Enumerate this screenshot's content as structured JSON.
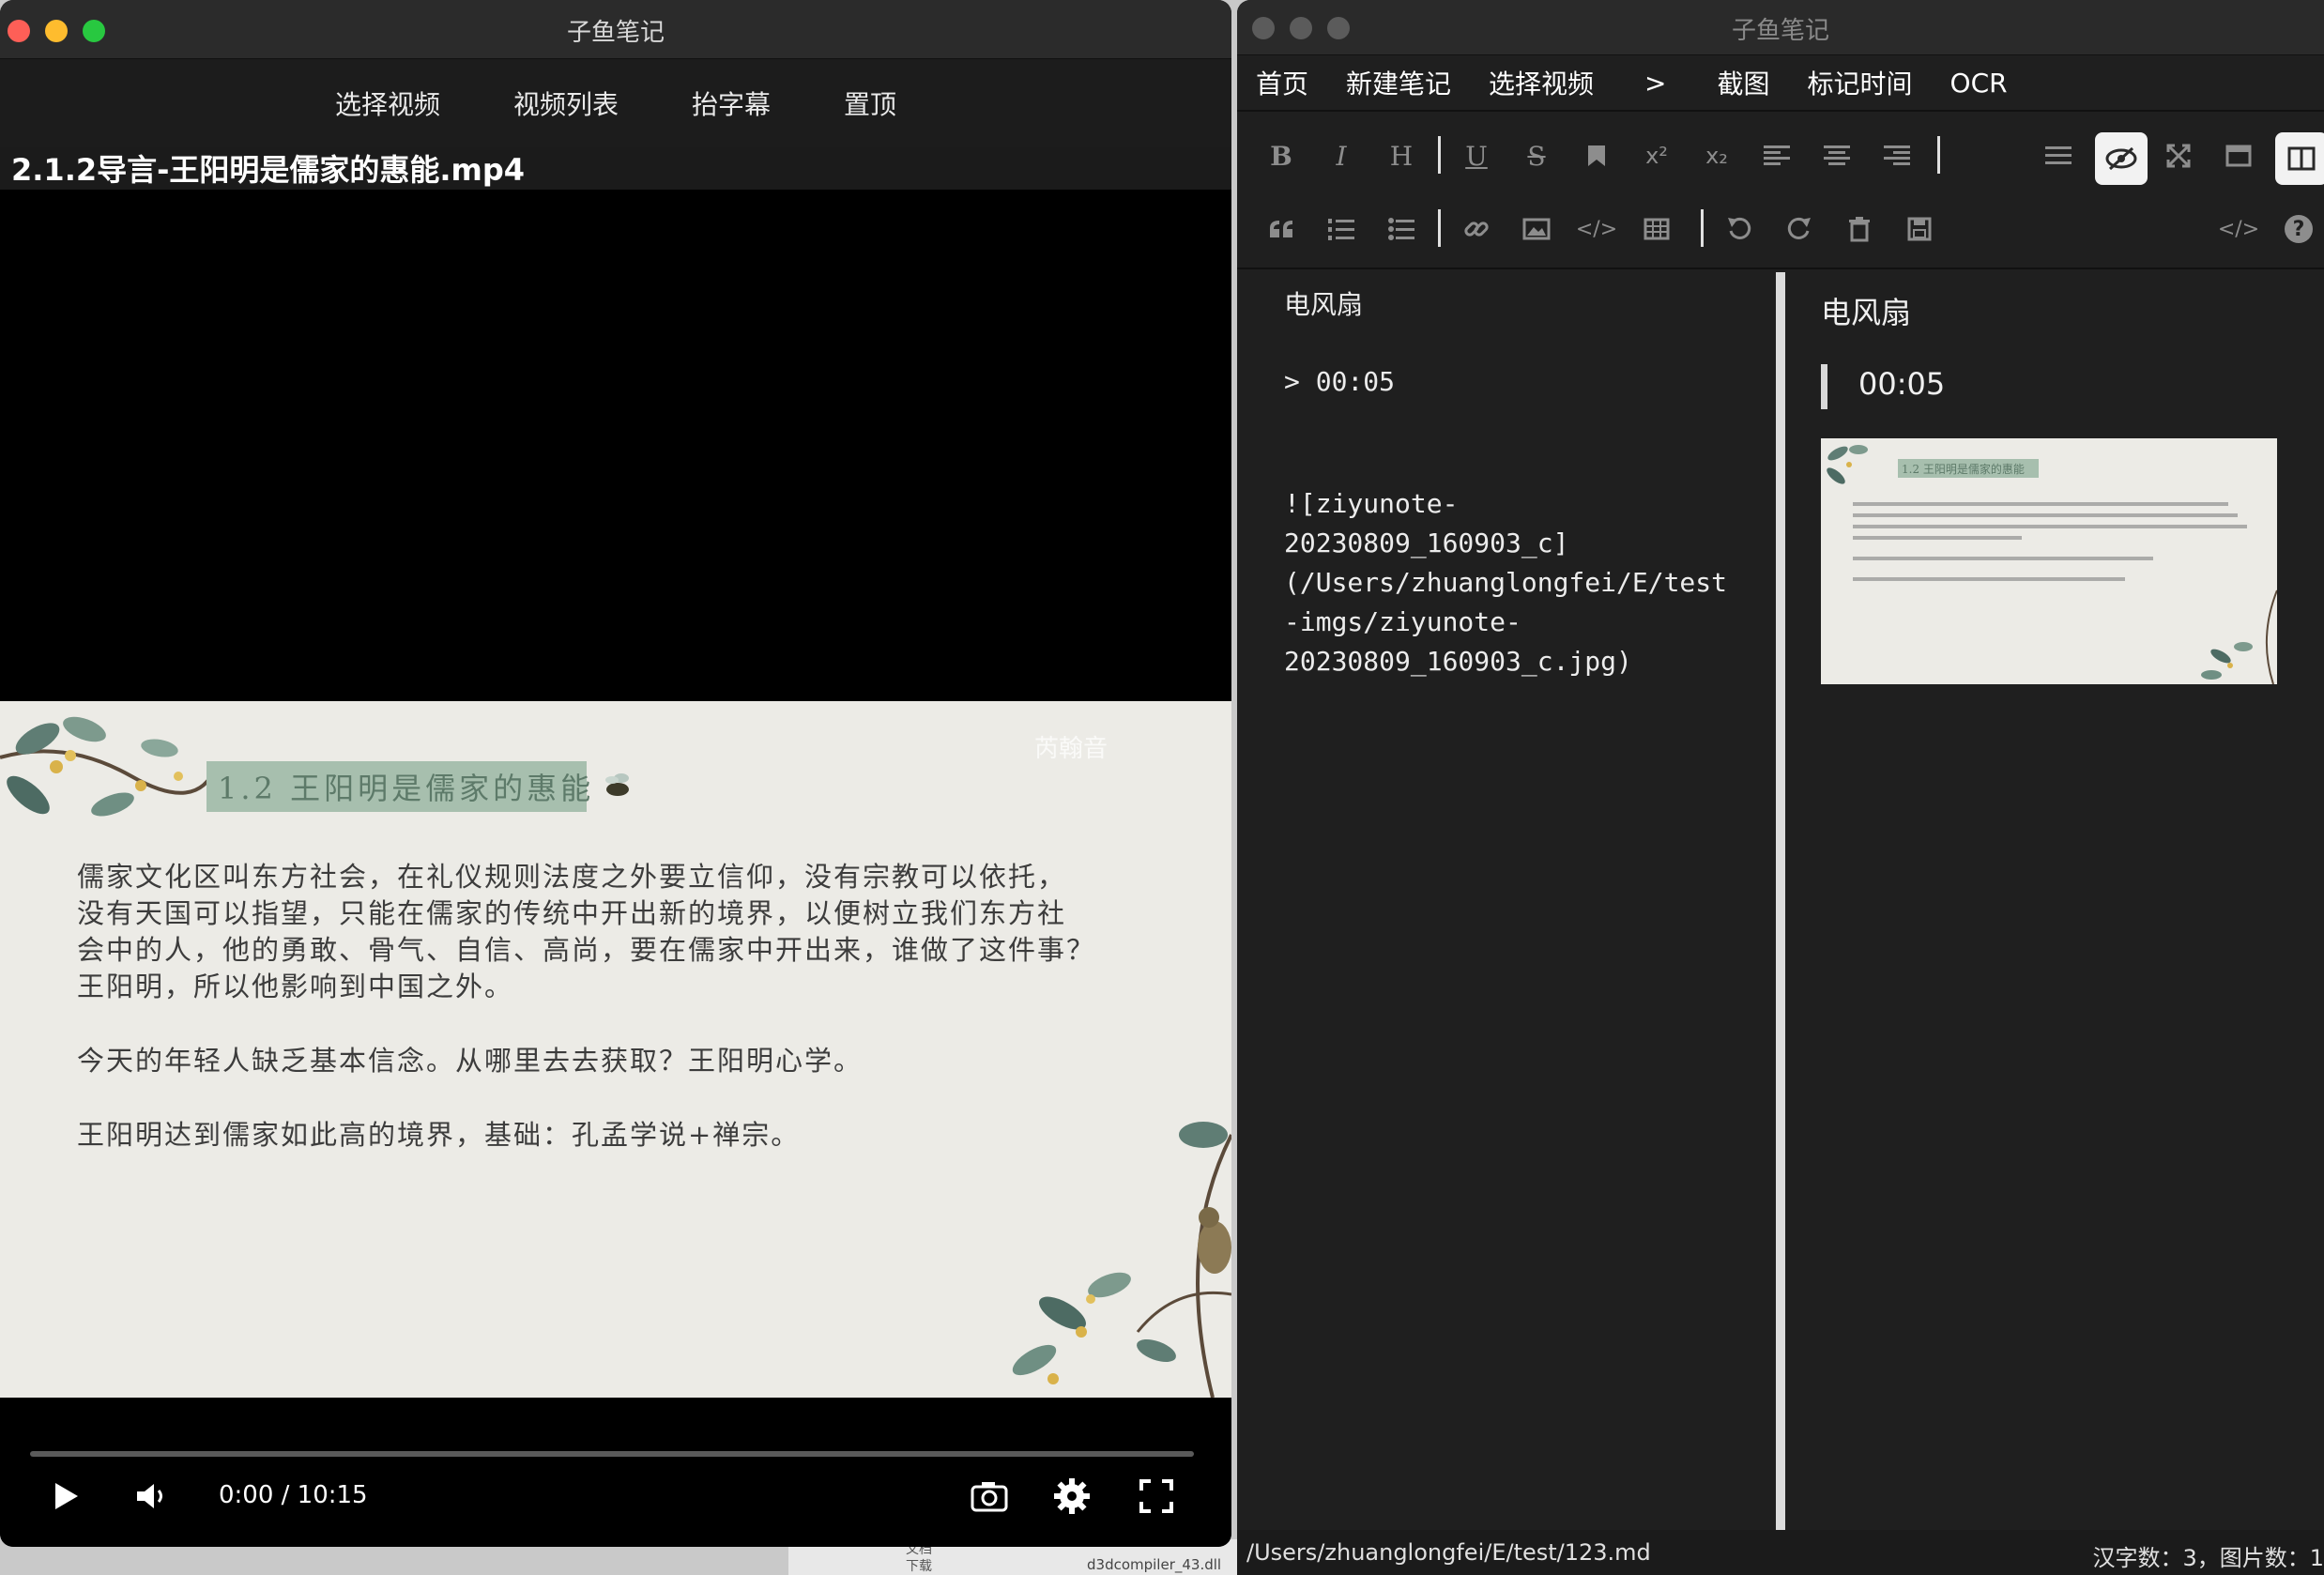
{
  "video_window": {
    "title": "子鱼笔记",
    "menu": [
      {
        "label": "选择视频"
      },
      {
        "label": "视频列表"
      },
      {
        "label": "抬字幕"
      },
      {
        "label": "置顶"
      }
    ],
    "filename": "2.1.2导言-王阳明是儒家的惠能.mp4",
    "slide": {
      "watermark": "芮翰音",
      "title": "1.2 王阳明是儒家的惠能",
      "paragraphs": [
        "儒家文化区叫东方社会，在礼仪规则法度之外要立信仰，没有宗教可以依托，",
        "没有天国可以指望，只能在儒家的传统中开出新的境界，以便树立我们东方社",
        "会中的人，他的勇敢、骨气、自信、高尚，要在儒家中开出来，谁做了这件事？",
        "王阳明，所以他影响到中国之外。",
        "今天的年轻人缺乏基本信念。从哪里去去获取？王阳明心学。",
        "王阳明达到儒家如此高的境界，基础：孔孟学说+禅宗。"
      ]
    },
    "player": {
      "time": "0:00 / 10:15",
      "progress": 0.0,
      "icons": [
        "play-icon",
        "volume-icon",
        "camera-icon",
        "settings-icon",
        "fullscreen-icon"
      ]
    },
    "traffic_colors": [
      "#fe5f57",
      "#febc2e",
      "#28c840"
    ]
  },
  "notes_window": {
    "title": "子鱼笔记",
    "menu": [
      {
        "label": "首页"
      },
      {
        "label": "新建笔记"
      },
      {
        "label": "选择视频"
      },
      {
        "label": ">"
      },
      {
        "label": "截图"
      },
      {
        "label": "标记时间"
      },
      {
        "label": "OCR"
      }
    ],
    "toolbar_row1": [
      "B",
      "I",
      "H",
      "U",
      "S",
      "bookmark",
      "x²",
      "x₂",
      "align-left",
      "align-center",
      "align-right"
    ],
    "toolbar_row2": [
      "quote",
      "ordered-list",
      "unordered-list",
      "link",
      "image",
      "code",
      "table",
      "undo",
      "redo",
      "delete",
      "save"
    ],
    "editor": {
      "lines": [
        "电风扇",
        "> 00:05",
        "![ziyunote-",
        "20230809_160903_c]",
        "(/Users/zhuanglongfei/E/test",
        "-imgs/ziyunote-",
        "20230809_160903_c.jpg)"
      ]
    },
    "preview": {
      "heading": "电风扇",
      "quote": "00:05",
      "thumb_title": "1.2 王阳明是儒家的惠能"
    },
    "status": {
      "path": "/Users/zhuanglongfei/E/test/123.md",
      "counts": "汉字数：3，图片数：1"
    }
  },
  "background": {
    "files": [
      "文档",
      "下载",
      "d3dcompiler_43.dll"
    ]
  }
}
